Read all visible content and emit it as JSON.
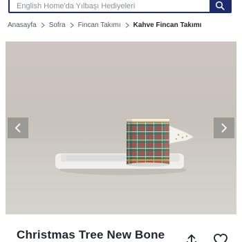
{
  "search": {
    "placeholder": "English Home'da Yılbaşı Hediyeleri",
    "icon": "search-icon"
  },
  "breadcrumb": {
    "items": [
      "Anasayfa",
      "Sofra",
      "Fincan Takımı"
    ],
    "current": "Kahve Fincan Takımı"
  },
  "gallery": {
    "prev_icon": "chevron-left-icon",
    "next_icon": "chevron-right-icon"
  },
  "product": {
    "title": "Christmas Tree New Bone",
    "share_icon": "share-icon",
    "favorite_icon": "heart-icon"
  },
  "colors": {
    "brand": "#1c2a6e",
    "background": "#ffffff"
  }
}
